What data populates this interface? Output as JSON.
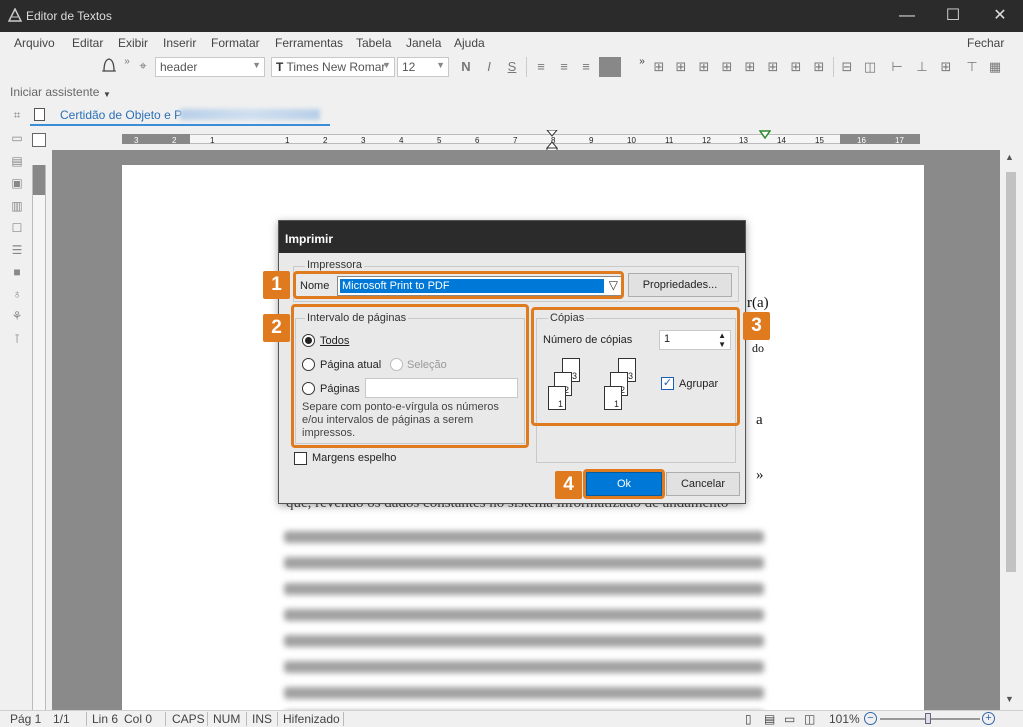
{
  "window": {
    "title": "Editor de Textos",
    "minimize": "—",
    "maximize": "☐",
    "close": "✕"
  },
  "menu": [
    "Arquivo",
    "Editar",
    "Exibir",
    "Inserir",
    "Formatar",
    "Ferramentas",
    "Tabela",
    "Janela",
    "Ajuda"
  ],
  "menu_close": "Fechar",
  "toolbar": {
    "style": "header",
    "font": "Times New Romar",
    "size": "12",
    "bold": "N",
    "italic": "I",
    "strike": "S"
  },
  "assistant": "Iniciar assistente",
  "document_tab": {
    "title": "Certidão de Objeto e P"
  },
  "ruler": {
    "labels": [
      "3",
      "2",
      "1",
      "1",
      "2",
      "3",
      "4",
      "5",
      "6",
      "7",
      "8",
      "9",
      "10",
      "11",
      "12",
      "13",
      "14",
      "15",
      "16",
      "17"
    ]
  },
  "document_fragments": [
    "r(a)",
    "do",
    "a",
    "»",
    "que, revendo os dados constantes no sistema informatizado de andamento"
  ],
  "dialog": {
    "title": "Imprimir",
    "printer_group": "Impressora",
    "name_label": "Nome",
    "printer": "Microsoft Print to PDF",
    "properties": "Propriedades...",
    "range_group": "Intervalo de páginas",
    "all": "Todos",
    "current": "Página atual",
    "selection": "Seleção",
    "pages": "Páginas",
    "pages_value": "",
    "hint": [
      "Separe com ponto-e-vírgula os números",
      "e/ou intervalos de páginas a serem",
      "impressos."
    ],
    "copies_group": "Cópias",
    "copies_label": "Número de cópias",
    "copies_value": "1",
    "collate": "Agrupar",
    "mirror": "Margens espelho",
    "ok": "Ok",
    "cancel": "Cancelar"
  },
  "callouts": [
    "1",
    "2",
    "3",
    "4"
  ],
  "status": {
    "page": "Pág 1",
    "count": "1/1",
    "line": "Lin 6",
    "col": "Col 0",
    "caps": "CAPS",
    "num": "NUM",
    "ins": "INS",
    "hyphen": "Hifenizado",
    "zoom": "101%"
  },
  "colors": {
    "accent": "#0078d7",
    "callout": "#e07a1e",
    "titlebar": "#2b2b2b"
  }
}
